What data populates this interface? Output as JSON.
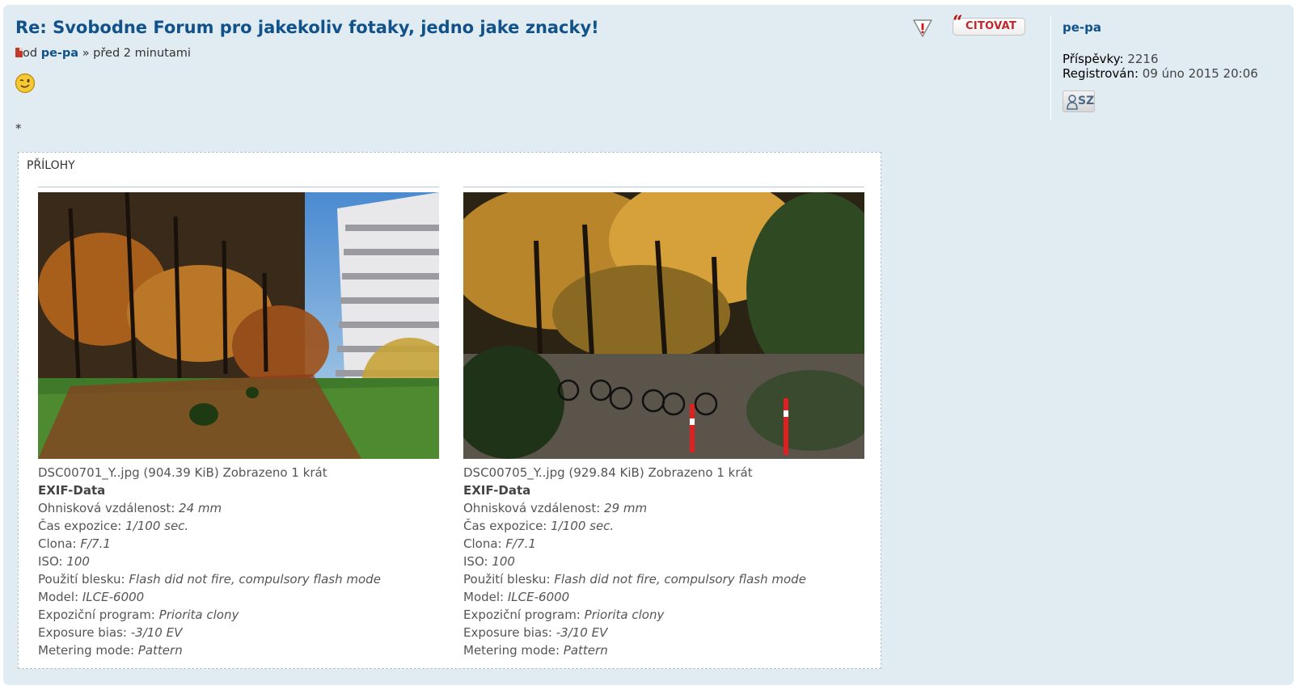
{
  "post": {
    "title": "Re: Svobodne Forum pro jakekoliv fotaky, jedno jake znacky!",
    "byline_prefix": "od",
    "author": "pe-pa",
    "byline_suffix": "» před 2 minutami",
    "body_text": "*",
    "quote_label": "CITOVAT"
  },
  "profile": {
    "username": "pe-pa",
    "posts_label": "Příspěvky:",
    "posts_value": "2216",
    "registered_label": "Registrován:",
    "registered_value": "09 úno 2015 20:06",
    "contact_label": "SZ"
  },
  "attachments": {
    "title": "PŘÍLOHY",
    "items": [
      {
        "filename": "DSC00701_Y..jpg",
        "size": "(904.39 KiB)",
        "views": "Zobrazeno 1 krát",
        "exif_title": "EXIF-Data",
        "focal_label": "Ohnisková vzdálenost:",
        "focal_value": "24 mm",
        "exposure_label": "Čas expozice:",
        "exposure_value": "1/100 sec.",
        "aperture_label": "Clona:",
        "aperture_value": "F/7.1",
        "iso_label": "ISO:",
        "iso_value": "100",
        "flash_label": "Použití blesku:",
        "flash_value": "Flash did not fire, compulsory flash mode",
        "model_label": "Model:",
        "model_value": "ILCE-6000",
        "program_label": "Expoziční program:",
        "program_value": "Priorita clony",
        "bias_label": "Exposure bias:",
        "bias_value": "-3/10 EV",
        "metering_label": "Metering mode:",
        "metering_value": "Pattern"
      },
      {
        "filename": "DSC00705_Y..jpg",
        "size": "(929.84 KiB)",
        "views": "Zobrazeno 1 krát",
        "exif_title": "EXIF-Data",
        "focal_label": "Ohnisková vzdálenost:",
        "focal_value": "29 mm",
        "exposure_label": "Čas expozice:",
        "exposure_value": "1/100 sec.",
        "aperture_label": "Clona:",
        "aperture_value": "F/7.1",
        "iso_label": "ISO:",
        "iso_value": "100",
        "flash_label": "Použití blesku:",
        "flash_value": "Flash did not fire, compulsory flash mode",
        "model_label": "Model:",
        "model_value": "ILCE-6000",
        "program_label": "Expoziční program:",
        "program_value": "Priorita clony",
        "bias_label": "Exposure bias:",
        "bias_value": "-3/10 EV",
        "metering_label": "Metering mode:",
        "metering_value": "Pattern"
      }
    ]
  },
  "colors": {
    "post_bg": "#e1ebf2",
    "link": "#105289",
    "quote_red": "#c0272d"
  },
  "icons": [
    "post-icon",
    "smiley-wink-icon",
    "report-icon",
    "quote-icon",
    "contact-user-icon"
  ]
}
